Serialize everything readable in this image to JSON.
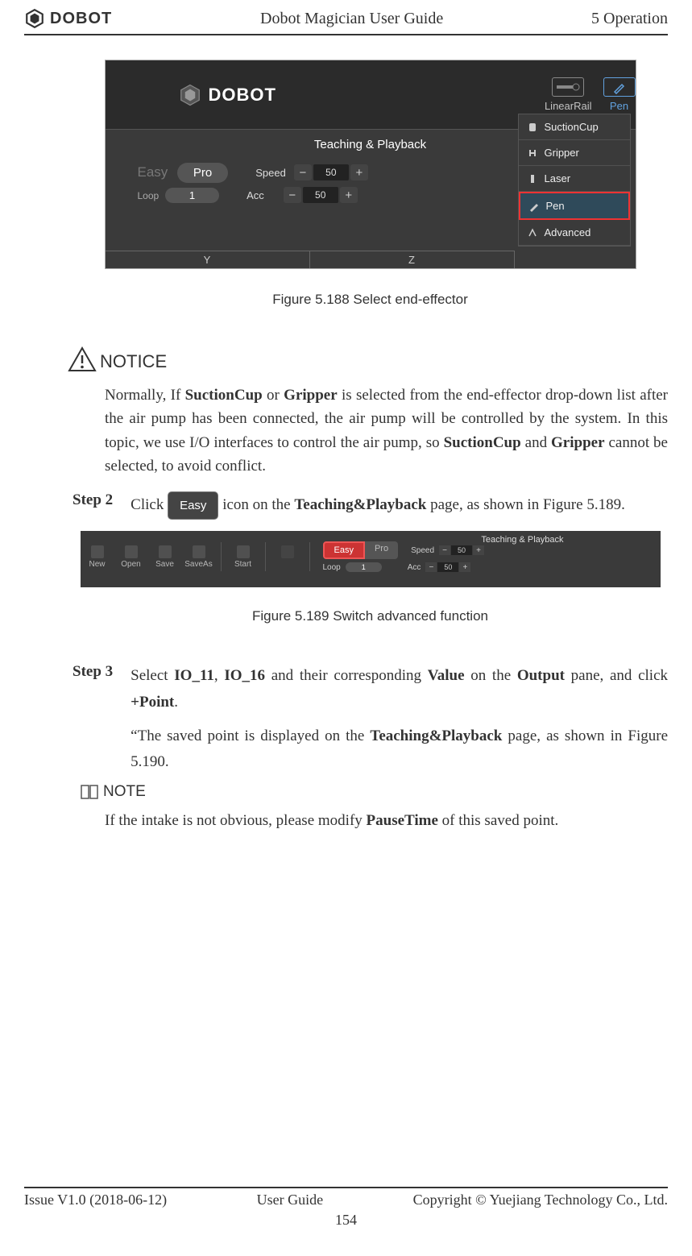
{
  "header": {
    "logo_text": "DOBOT",
    "center": "Dobot Magician User Guide",
    "right": "5 Operation"
  },
  "shot1": {
    "brand": "DOBOT",
    "linear_rail": "LinearRail",
    "pen": "Pen",
    "title": "Teaching & Playback",
    "easy": "Easy",
    "pro": "Pro",
    "loop_label": "Loop",
    "loop_val": "1",
    "speed_label": "Speed",
    "acc_label": "Acc",
    "speed_val": "50",
    "acc_val": "50",
    "axis_y": "Y",
    "axis_z": "Z",
    "dd": {
      "suction": "SuctionCup",
      "gripper": "Gripper",
      "laser": "Laser",
      "pen": "Pen",
      "advanced": "Advanced"
    }
  },
  "caption1": "Figure 5.188    Select end-effector",
  "notice_label": "NOTICE",
  "notice_text_1": "Normally, If ",
  "notice_b1": "SuctionCup",
  "notice_or": " or ",
  "notice_b2": "Gripper",
  "notice_text_2": " is selected from the end-effector drop-down list after the air pump has been connected, the air pump will be controlled by the system. In this topic, we use I/O interfaces to control the air pump, so ",
  "notice_b3": "SuctionCup",
  "notice_and": " and ",
  "notice_b4": "Gripper",
  "notice_text_3": " cannot be selected, to avoid conflict.",
  "step2_label": "Step 2",
  "step2_a": "Click ",
  "step2_btn": "Easy",
  "step2_b": " icon on the ",
  "step2_bold": "Teaching&Playback",
  "step2_c": " page, as shown in Figure 5.189.",
  "shot2": {
    "title": "Teaching & Playback",
    "new": "New",
    "open": "Open",
    "save": "Save",
    "saveas": "SaveAs",
    "start": "Start",
    "easy": "Easy",
    "pro": "Pro",
    "loop": "Loop",
    "loopv": "1",
    "speed": "Speed",
    "speedv": "50",
    "acc": "Acc",
    "accv": "50"
  },
  "caption2": "Figure 5.189    Switch advanced function",
  "step3_label": "Step 3",
  "step3_a": "Select ",
  "step3_b1": "IO_11",
  "step3_comma": ", ",
  "step3_b2": "IO_16",
  "step3_b": " and their corresponding ",
  "step3_b3": "Value",
  "step3_c": " on the ",
  "step3_b4": "Output",
  "step3_d": " pane, and click ",
  "step3_b5": "+Point",
  "step3_e": ".",
  "step3_p2a": "“The saved point is displayed on the ",
  "step3_p2b": "Teaching&Playback",
  "step3_p2c": " page, as shown in Figure 5.190.",
  "note_label": "NOTE",
  "note_text_a": "If the intake is not obvious, please modify ",
  "note_bold": "PauseTime",
  "note_text_b": " of this saved point.",
  "footer": {
    "left": "Issue V1.0 (2018-06-12)",
    "center": "User Guide",
    "right": "Copyright © Yuejiang Technology Co., Ltd.",
    "page": "154"
  }
}
